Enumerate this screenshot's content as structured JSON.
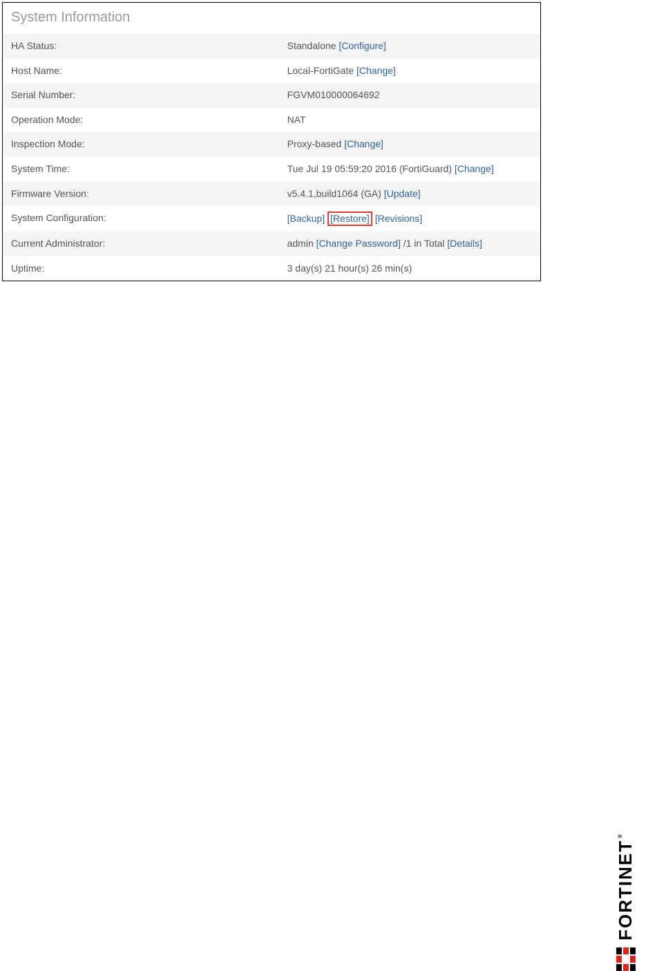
{
  "panel": {
    "title": "System Information",
    "rows": {
      "ha_status": {
        "label": "HA Status:",
        "value": "Standalone",
        "actions": [
          "Configure"
        ]
      },
      "host_name": {
        "label": "Host Name:",
        "value": "Local-FortiGate",
        "actions": [
          "Change"
        ]
      },
      "serial": {
        "label": "Serial Number:",
        "value": "FGVM010000064692",
        "actions": []
      },
      "op_mode": {
        "label": "Operation Mode:",
        "value": "NAT",
        "actions": []
      },
      "insp_mode": {
        "label": "Inspection Mode:",
        "value": "Proxy-based",
        "actions": [
          "Change"
        ]
      },
      "sys_time": {
        "label": "System Time:",
        "value": "Tue Jul 19 05:59:20 2016 (FortiGuard)",
        "actions": [
          "Change"
        ]
      },
      "fw": {
        "label": "Firmware Version:",
        "value": "v5.4.1,build1064 (GA)",
        "actions": [
          "Update"
        ]
      },
      "sys_cfg": {
        "label": "System Configuration:",
        "actions": [
          "Backup",
          "Restore",
          "Revisions"
        ],
        "highlight": "Restore"
      },
      "admin": {
        "label": "Current Administrator:",
        "value_pre": "admin",
        "action1": "Change Password",
        "value_mid": "/1 in Total",
        "action2": "Details"
      },
      "uptime": {
        "label": "Uptime:",
        "value": "3 day(s) 21 hour(s) 26 min(s)",
        "actions": []
      }
    }
  },
  "brand": "FORTINET"
}
